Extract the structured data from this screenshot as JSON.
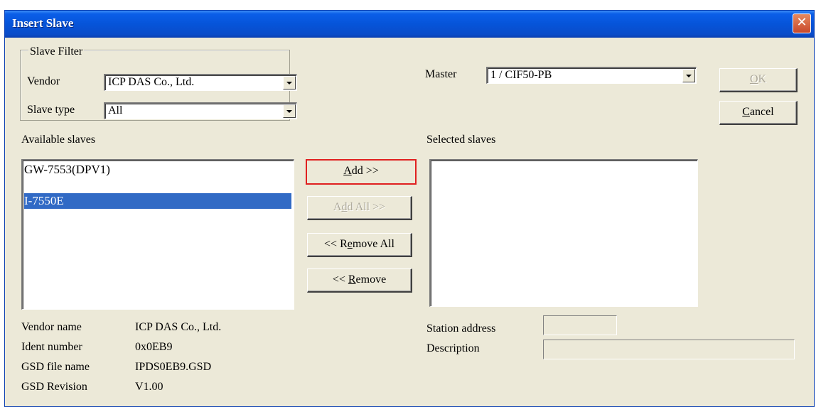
{
  "window": {
    "title": "Insert Slave",
    "close_glyph": "✕"
  },
  "slave_filter": {
    "legend": "Slave Filter",
    "vendor_label": "Vendor",
    "vendor_value": "ICP DAS Co., Ltd.",
    "slave_type_label": "Slave type",
    "slave_type_value": "All"
  },
  "master": {
    "label": "Master",
    "value": "1 / CIF50-PB"
  },
  "buttons": {
    "ok": {
      "label": "OK",
      "underline": "O",
      "rest": "K",
      "enabled": false
    },
    "cancel": {
      "label": "Cancel",
      "underline": "C",
      "rest": "ancel",
      "enabled": true
    },
    "add": {
      "label": "Add >>",
      "underline": "A",
      "rest": "dd >>",
      "enabled": true,
      "highlighted": true
    },
    "add_all": {
      "label": "Add All >>",
      "pre": "A",
      "underline": "d",
      "rest": "d All >>",
      "enabled": false
    },
    "remove_all": {
      "label": "<< Remove All",
      "pre": "<< R",
      "underline": "e",
      "rest": "move All",
      "enabled": true
    },
    "remove": {
      "label": "<< Remove",
      "pre": "<< ",
      "underline": "R",
      "rest": "emove",
      "enabled": true
    }
  },
  "available_slaves": {
    "label": "Available slaves",
    "items": [
      {
        "text": "GW-7553(DPV1)",
        "selected": false
      },
      {
        "text": "I-7550E",
        "selected": true
      }
    ]
  },
  "selected_slaves": {
    "label": "Selected slaves",
    "items": []
  },
  "slave_info": {
    "vendor_name_label": "Vendor name",
    "vendor_name_value": "ICP DAS Co., Ltd.",
    "ident_number_label": "Ident number",
    "ident_number_value": "0x0EB9",
    "gsd_file_label": "GSD file name",
    "gsd_file_value": "IPDS0EB9.GSD",
    "gsd_revision_label": "GSD Revision",
    "gsd_revision_value": "V1.00"
  },
  "station": {
    "address_label": "Station address",
    "address_value": "",
    "description_label": "Description",
    "description_value": ""
  },
  "colors": {
    "titlebar": "#0a5ee8",
    "dialog_bg": "#ece9d8",
    "selection": "#316ac5",
    "highlight_border": "#e02020"
  }
}
